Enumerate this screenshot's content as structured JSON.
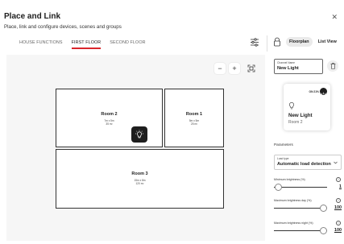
{
  "header": {
    "title": "Place and Link",
    "subtitle": "Place, link and configure devices, scenes and groups",
    "close_icon": "close-icon"
  },
  "tabs": [
    "HOUSE FUNCTIONS",
    "FIRST FLOOR",
    "SECOND FLOOR"
  ],
  "active_tab": "FIRST FLOOR",
  "toolbar": {
    "filter_icon": "sliders-icon",
    "lock_icon": "lock-icon",
    "view_options": [
      "Floorplan",
      "List View"
    ],
    "active_view": "Floorplan"
  },
  "canvas": {
    "zoom_out": "−",
    "zoom_in": "+",
    "fit_icon": "fit-screen-icon"
  },
  "rooms": [
    {
      "name": "Room 2",
      "size": "7m x 5m",
      "area": "35 m²"
    },
    {
      "name": "Room 1",
      "size": "5m x 5m",
      "area": "25 m²"
    },
    {
      "name": "Room 3",
      "size": "15m x 8m",
      "area": "120 m²"
    }
  ],
  "device": {
    "icon": "light-bulb-icon"
  },
  "panel": {
    "channel_label": "Channel Name",
    "channel_value": "New Light",
    "trash_icon": "trash-icon",
    "card": {
      "status": "ON 21%",
      "name": "New Light",
      "room": "Room 2",
      "bulb_icon": "light-bulb-icon",
      "power_icon": "power-icon"
    },
    "parameters_title": "Parameters",
    "load_type_label": "Load type",
    "load_type_value": "Automatic load detection",
    "sliders": [
      {
        "label": "Minimum brightness (%)",
        "value": "1",
        "level": 0.01
      },
      {
        "label": "Maximum brightness day (%)",
        "value": "100",
        "level": 1.0
      },
      {
        "label": "Maximum brightness night (%)",
        "value": "100",
        "level": 1.0
      }
    ]
  },
  "colors": {
    "accent": "#d9262b",
    "dark": "#1e1e1e",
    "canvas_bg": "#f6f6f6"
  }
}
